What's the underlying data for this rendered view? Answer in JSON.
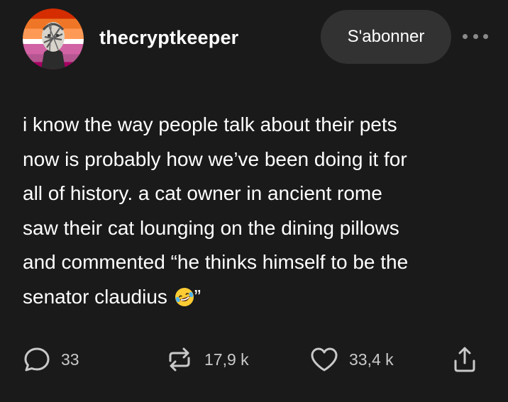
{
  "post": {
    "author": {
      "username": "thecryptkeeper",
      "avatar_icon": "avatar-lesbian-flag-portrait"
    },
    "follow_label": "S'abonner",
    "more_icon": "more-horizontal-icon",
    "body_lines": [
      "i know the way people talk about their pets",
      "now is probably how we’ve been doing it for",
      "all of history. a cat owner in ancient rome",
      "saw their cat lounging on the dining pillows",
      "and commented “he thinks himself to be the",
      "senator claudius"
    ],
    "body_end": "”",
    "emoji": "rolling-on-floor-laughing"
  },
  "actions": {
    "comments": {
      "icon": "comment-bubble-icon",
      "count": "33"
    },
    "reblogs": {
      "icon": "reblog-icon",
      "count": "17,9 k"
    },
    "likes": {
      "icon": "heart-icon",
      "count": "33,4 k"
    },
    "share": {
      "icon": "share-icon"
    }
  },
  "colors": {
    "background": "#1a1a1a",
    "text": "#ffffff",
    "secondary_text": "#c9c9c9",
    "button_background": "#323232"
  }
}
